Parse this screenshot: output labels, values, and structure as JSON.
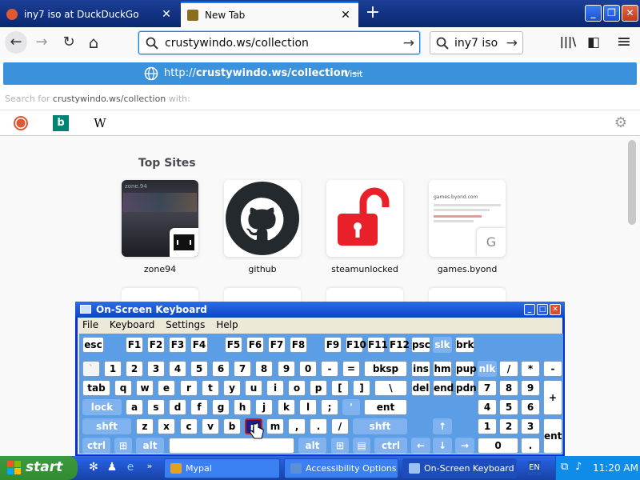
{
  "browser": {
    "tabs": [
      {
        "title": "iny7 iso at DuckDuckGo",
        "close": "✕",
        "favicon_color": "#de5833"
      },
      {
        "title": "New Tab",
        "close": "✕",
        "favicon_color": "#8a6d1e"
      }
    ],
    "new_tab": "+",
    "window_controls": {
      "minimize": "_",
      "maximize": "❐",
      "close": "✕"
    },
    "nav": {
      "back": "←",
      "forward": "→",
      "reload": "↻",
      "home": "⌂"
    },
    "url_value": "crustywindo.ws/collection",
    "search_value": "iny7 iso",
    "go_arrow": "→",
    "toolbar": {
      "library": "|||\\",
      "sidebar": "◧",
      "menu": "≡"
    }
  },
  "popup": {
    "visit_url_prefix": "http://",
    "visit_url_bold": "crustywindo.ws/collection",
    "visit_sep": " — ",
    "visit_action": "Visit",
    "search_for_prefix": "Search for ",
    "search_for_query": "crustywindo.ws/collection",
    "search_for_suffix": " with:",
    "engines": [
      {
        "name": "duckduckgo-icon",
        "glyph": "●",
        "color": "#de5833"
      },
      {
        "name": "bing-icon",
        "glyph": "b",
        "color": "#008373"
      },
      {
        "name": "wikipedia-icon",
        "glyph": "W",
        "color": "#000"
      }
    ],
    "settings_glyph": "⚙"
  },
  "newtab": {
    "section_title": "Top Sites",
    "sites": [
      {
        "label": "zone94",
        "thumb_text": "zone.94"
      },
      {
        "label": "github"
      },
      {
        "label": "steamunlocked"
      },
      {
        "label": "games.byond",
        "thumb_text": "games.byond.com",
        "mini": "G"
      }
    ]
  },
  "osk": {
    "title": "On-Screen Keyboard",
    "menu": [
      "File",
      "Keyboard",
      "Settings",
      "Help"
    ],
    "window_controls": {
      "minimize": "_",
      "maximize": "□",
      "close": "✕"
    }
  },
  "taskbar": {
    "start": "start",
    "tasks": [
      {
        "label": "Mypal",
        "color": "#e6a020"
      },
      {
        "label": "Accessibility Options",
        "color": "#5b8fd6"
      },
      {
        "label": "On-Screen Keyboard",
        "color": "#9cc3f0"
      }
    ],
    "lang": "EN",
    "clock": "11:20 AM"
  }
}
